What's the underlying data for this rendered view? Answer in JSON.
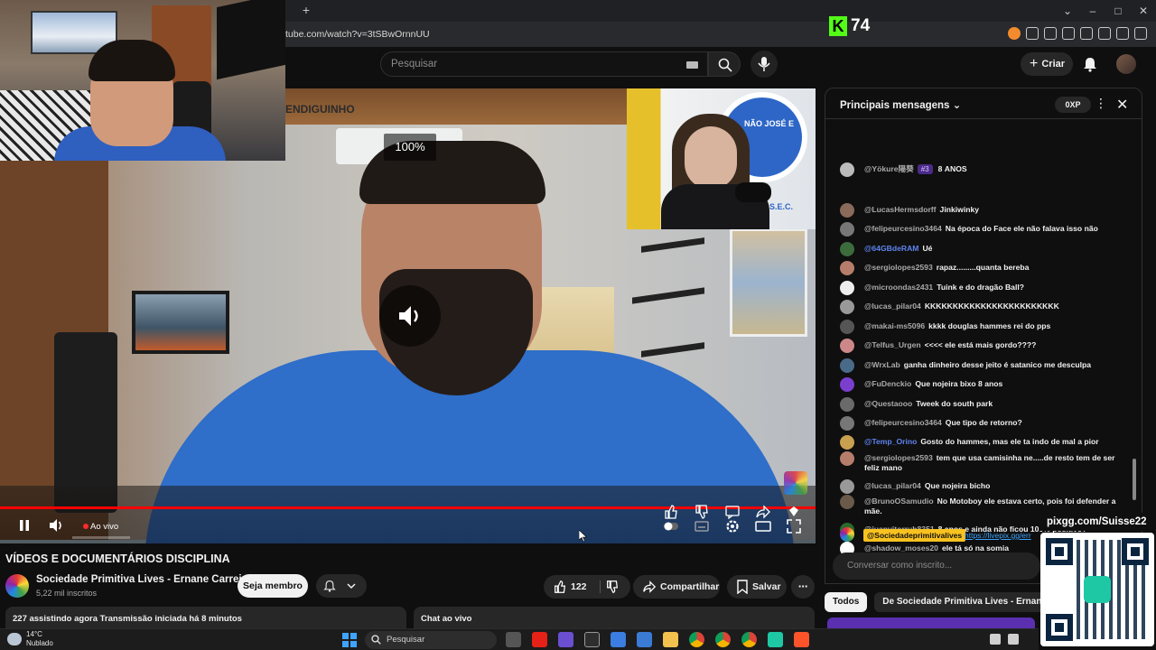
{
  "browser": {
    "url": "tube.com/watch?v=3tSBwOrnnUU",
    "new_tab_label": "+"
  },
  "overlay": {
    "kick_letter": "K",
    "kick_number": "74",
    "qr_caption": "pixgg.com/Suisse22"
  },
  "header": {
    "search_placeholder": "Pesquisar",
    "create_label": "Criar"
  },
  "player": {
    "channel_watermark": "ENDIGUINHO",
    "volume_percent": "100%",
    "live_label": "Ao vivo",
    "progress": 1.0,
    "guest_banner_text": "NÃO JOSÉ E",
    "guest_banner_text2": "S.E.C."
  },
  "video": {
    "title": "VÍDEOS E DOCUMENTÁRIOS DISCIPLINA",
    "channel_name": "Sociedade Primitiva Lives - Ernane Carreira",
    "subscribers": "5,22 mil inscritos",
    "member_button": "Seja membro",
    "like_count": "122",
    "share_label": "Compartilhar",
    "save_label": "Salvar",
    "watching": "227 assistindo agora  Transmissão iniciada há 8 minutos",
    "chat_toggle": "Chat ao vivo"
  },
  "chat": {
    "header_title": "Principais mensagens",
    "xp_label": "0XP",
    "messages": [
      {
        "author": "@Yökure陽葵",
        "badge": "#3",
        "text": "8 ANOS",
        "author_color": "normal"
      },
      {
        "author": "@LucasHermsdorff",
        "text": "Jinkiwinky",
        "author_color": "normal"
      },
      {
        "author": "@felipeurcesino3464",
        "text": "Na época do Face ele não falava isso não",
        "author_color": "normal"
      },
      {
        "author": "@64GBdeRAM",
        "text": "Ué",
        "author_color": "blue"
      },
      {
        "author": "@sergiolopes2593",
        "text": "rapaz.........quanta bereba",
        "author_color": "normal"
      },
      {
        "author": "@microondas2431",
        "text": "Tuink e do dragão Ball?",
        "author_color": "normal"
      },
      {
        "author": "@lucas_pilar04",
        "text": "KKKKKKKKKKKKKKKKKKKKKKKK",
        "author_color": "normal"
      },
      {
        "author": "@makai-ms5096",
        "text": "kkkk douglas hammes rei do pps",
        "author_color": "normal"
      },
      {
        "author": "@Telfus_Urgen",
        "text": "<<<< ele está mais gordo????",
        "author_color": "normal"
      },
      {
        "author": "@WrxLab",
        "text": "ganha dinheiro desse jeito é satanico me desculpa",
        "author_color": "normal"
      },
      {
        "author": "@FuDenckio",
        "text": "Que nojeira bixo 8 anos",
        "author_color": "normal"
      },
      {
        "author": "@Questaooo",
        "text": "Tweek do south park",
        "author_color": "normal"
      },
      {
        "author": "@felipeurcesino3464",
        "text": "Que tipo de retorno?",
        "author_color": "normal"
      },
      {
        "author": "@Temp_Orino",
        "text": "Gosto do hammes, mas ele ta indo de mal a pior",
        "author_color": "blue"
      },
      {
        "author": "@sergiolopes2593",
        "text": "tem que usa camisinha ne.....de resto tem de ser feliz mano",
        "author_color": "normal"
      },
      {
        "author": "@lucas_pilar04",
        "text": "Que nojeira bicho",
        "author_color": "normal"
      },
      {
        "author": "@BrunoOSamudio",
        "text": "No Motoboy ele estava certo, pois foi defender a mãe.",
        "author_color": "normal"
      },
      {
        "author": "@juanvitorruh8351",
        "text": "8 anos e ainda não ficou 100% positivo?",
        "author_color": "normal"
      },
      {
        "author": "@shadow_moses20",
        "text": "ele tá só na somia",
        "author_color": "normal"
      }
    ],
    "pinned_author": "@Sociedadeprimitivalives",
    "pinned_link": "https://livepix.gg/err",
    "input_placeholder": "Conversar como inscrito...",
    "chips": [
      "Todos",
      "De Sociedade Primitiva Lives - Ernane Carr"
    ]
  },
  "taskbar": {
    "temperature": "14°C",
    "weather": "Nublado",
    "search_label": "Pesquisar"
  },
  "colors": {
    "accent_red": "#ff0000",
    "kick_green": "#53fc18",
    "pinned_yellow": "#f9c21f",
    "link_blue": "#3ea6ff"
  }
}
